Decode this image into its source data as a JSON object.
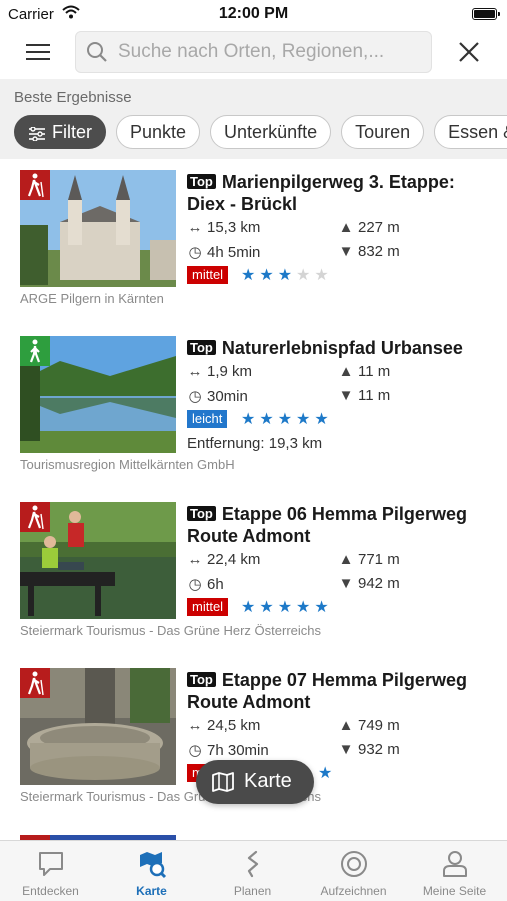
{
  "status_bar": {
    "carrier": "Carrier",
    "time": "12:00 PM"
  },
  "search": {
    "placeholder": "Suche nach Orten, Regionen,..."
  },
  "filter_section": {
    "label": "Beste Ergebnisse",
    "chips": [
      "Filter",
      "Punkte",
      "Unterkünfte",
      "Touren",
      "Essen &"
    ]
  },
  "results": [
    {
      "badge": "Top",
      "title": "Marienpilgerweg 3. Etappe: Diex - Brückl",
      "distance": "15,3 km",
      "duration": "4h 5min",
      "ascent": "227 m",
      "descent": "832 m",
      "difficulty": "mittel",
      "rating": 3,
      "rating_max": 5,
      "source": "ARGE Pilgern in Kärnten",
      "category_color": "#b71c1c"
    },
    {
      "badge": "Top",
      "title": "Naturerlebnispfad Urbansee",
      "distance": "1,9 km",
      "duration": "30min",
      "ascent": "11 m",
      "descent": "11 m",
      "difficulty": "leicht",
      "rating": 5,
      "rating_max": 5,
      "away": "Entfernung: 19,3 km",
      "source": "Tourismusregion Mittelkärnten GmbH",
      "category_color": "#2e9e3e"
    },
    {
      "badge": "Top",
      "title": "Etappe 06 Hemma Pilgerweg Route Admont",
      "distance": "22,4 km",
      "duration": "6h",
      "ascent": "771 m",
      "descent": "942 m",
      "difficulty": "mittel",
      "rating": 5,
      "rating_max": 5,
      "source": "Steiermark Tourismus - Das Grüne Herz Österreichs",
      "category_color": "#b71c1c"
    },
    {
      "badge": "Top",
      "title": "Etappe 07 Hemma Pilgerweg Route Admont",
      "distance": "24,5 km",
      "duration": "7h 30min",
      "ascent": "749 m",
      "descent": "932 m",
      "difficulty": "m",
      "rating": 5,
      "rating_max": 5,
      "source": "Steiermark Tourismus - Das Grüne Herz Österreichs",
      "category_color": "#b71c1c"
    }
  ],
  "map_button": {
    "label": "Karte"
  },
  "tab_bar": {
    "tabs": [
      {
        "label": "Entdecken",
        "icon": "chat-bubble-icon"
      },
      {
        "label": "Karte",
        "icon": "map-search-icon",
        "active": true
      },
      {
        "label": "Planen",
        "icon": "route-icon"
      },
      {
        "label": "Aufzeichnen",
        "icon": "record-icon"
      },
      {
        "label": "Meine Seite",
        "icon": "person-icon"
      }
    ]
  },
  "colors": {
    "accent": "#1d6fb8",
    "mittel": "#cc0000",
    "leicht": "#2277cc",
    "star": "#1d79c8"
  }
}
